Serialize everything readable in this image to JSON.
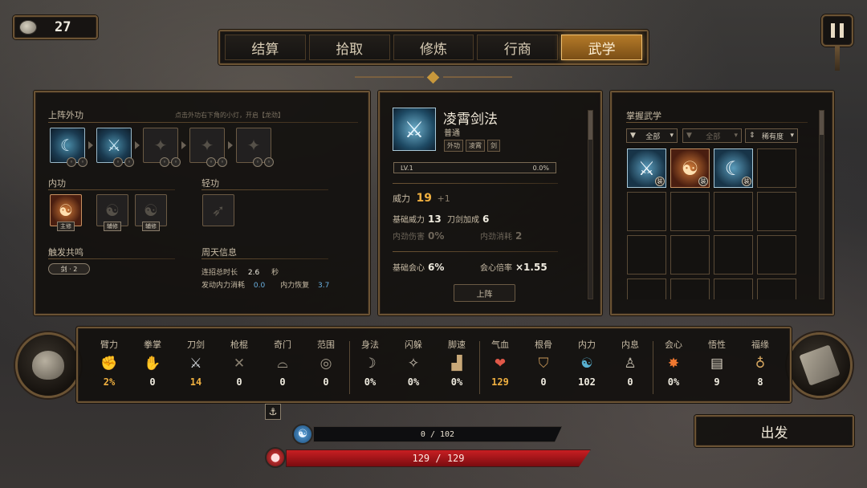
{
  "currency": {
    "value": "27",
    "icon": "coin-icon"
  },
  "tabs": [
    {
      "label": "结算",
      "active": false
    },
    {
      "label": "拾取",
      "active": false
    },
    {
      "label": "修炼",
      "active": false
    },
    {
      "label": "行商",
      "active": false
    },
    {
      "label": "武学",
      "active": true
    }
  ],
  "left": {
    "external_title": "上阵外功",
    "external_hint": "点击外功右下角的小灯，开启【龙劲】",
    "internal_title": "内功",
    "internal_roles": [
      "主修",
      "辅修",
      "辅修"
    ],
    "light_title": "轻功",
    "resonance_title": "触发共鸣",
    "resonance_value": "剑 · 2",
    "cycle_title": "周天信息",
    "cycle_total_label": "连招总时长",
    "cycle_total_value": "2.6",
    "cycle_total_unit": "秒",
    "cycle_cost_label": "发动内力消耗",
    "cycle_cost_value": "0.0",
    "cycle_recover_label": "内力恢复",
    "cycle_recover_value": "3.7"
  },
  "mid": {
    "name": "凌霄剑法",
    "grade": "普通",
    "tags": [
      "外功",
      "凌霄",
      "剑"
    ],
    "level": "LV.1",
    "progress": "0.0%",
    "power_label": "威力",
    "power_value": "19",
    "power_bonus": "+1",
    "base_power_label": "基础威力",
    "base_power_value": "13",
    "blade_bonus_label": "刀剑加成",
    "blade_bonus_value": "6",
    "inner_damage_label": "内劲伤害",
    "inner_damage_value": "0%",
    "inner_cost_label": "内劲消耗",
    "inner_cost_value": "2",
    "base_crit_label": "基础会心",
    "base_crit_value": "6%",
    "crit_mult_label": "会心倍率",
    "crit_mult_value": "×1.55",
    "equip_label": "上阵"
  },
  "right": {
    "title": "掌握武学",
    "filter_all": "全部",
    "filter_all2": "全部",
    "filter_sort": "稀有度",
    "equip_badge": "装"
  },
  "attributes": [
    {
      "label": "臂力",
      "value": "2%",
      "icon": "arm-icon"
    },
    {
      "label": "拳掌",
      "value": "0",
      "icon": "fist-icon"
    },
    {
      "label": "刀剑",
      "value": "14",
      "icon": "swords-icon",
      "highlight": true
    },
    {
      "label": "枪棍",
      "value": "0",
      "icon": "spear-icon"
    },
    {
      "label": "奇门",
      "value": "0",
      "icon": "fan-icon"
    },
    {
      "label": "范围",
      "value": "0",
      "icon": "target-icon"
    },
    {
      "label": "身法",
      "value": "0%",
      "icon": "sickle-icon"
    },
    {
      "label": "闪躲",
      "value": "0%",
      "icon": "dodge-icon"
    },
    {
      "label": "脚速",
      "value": "0%",
      "icon": "boot-icon"
    },
    {
      "label": "气血",
      "value": "129",
      "icon": "heart-icon",
      "highlight": true
    },
    {
      "label": "根骨",
      "value": "0",
      "icon": "shield-icon"
    },
    {
      "label": "内力",
      "value": "102",
      "icon": "yinyang-icon"
    },
    {
      "label": "内息",
      "value": "0",
      "icon": "meditate-icon"
    },
    {
      "label": "会心",
      "value": "0%",
      "icon": "crit-icon"
    },
    {
      "label": "悟性",
      "value": "9",
      "icon": "book-icon"
    },
    {
      "label": "福缘",
      "value": "8",
      "icon": "gourd-icon"
    }
  ],
  "mana": "0 / 102",
  "hp": "129 / 129",
  "depart_label": "出发"
}
